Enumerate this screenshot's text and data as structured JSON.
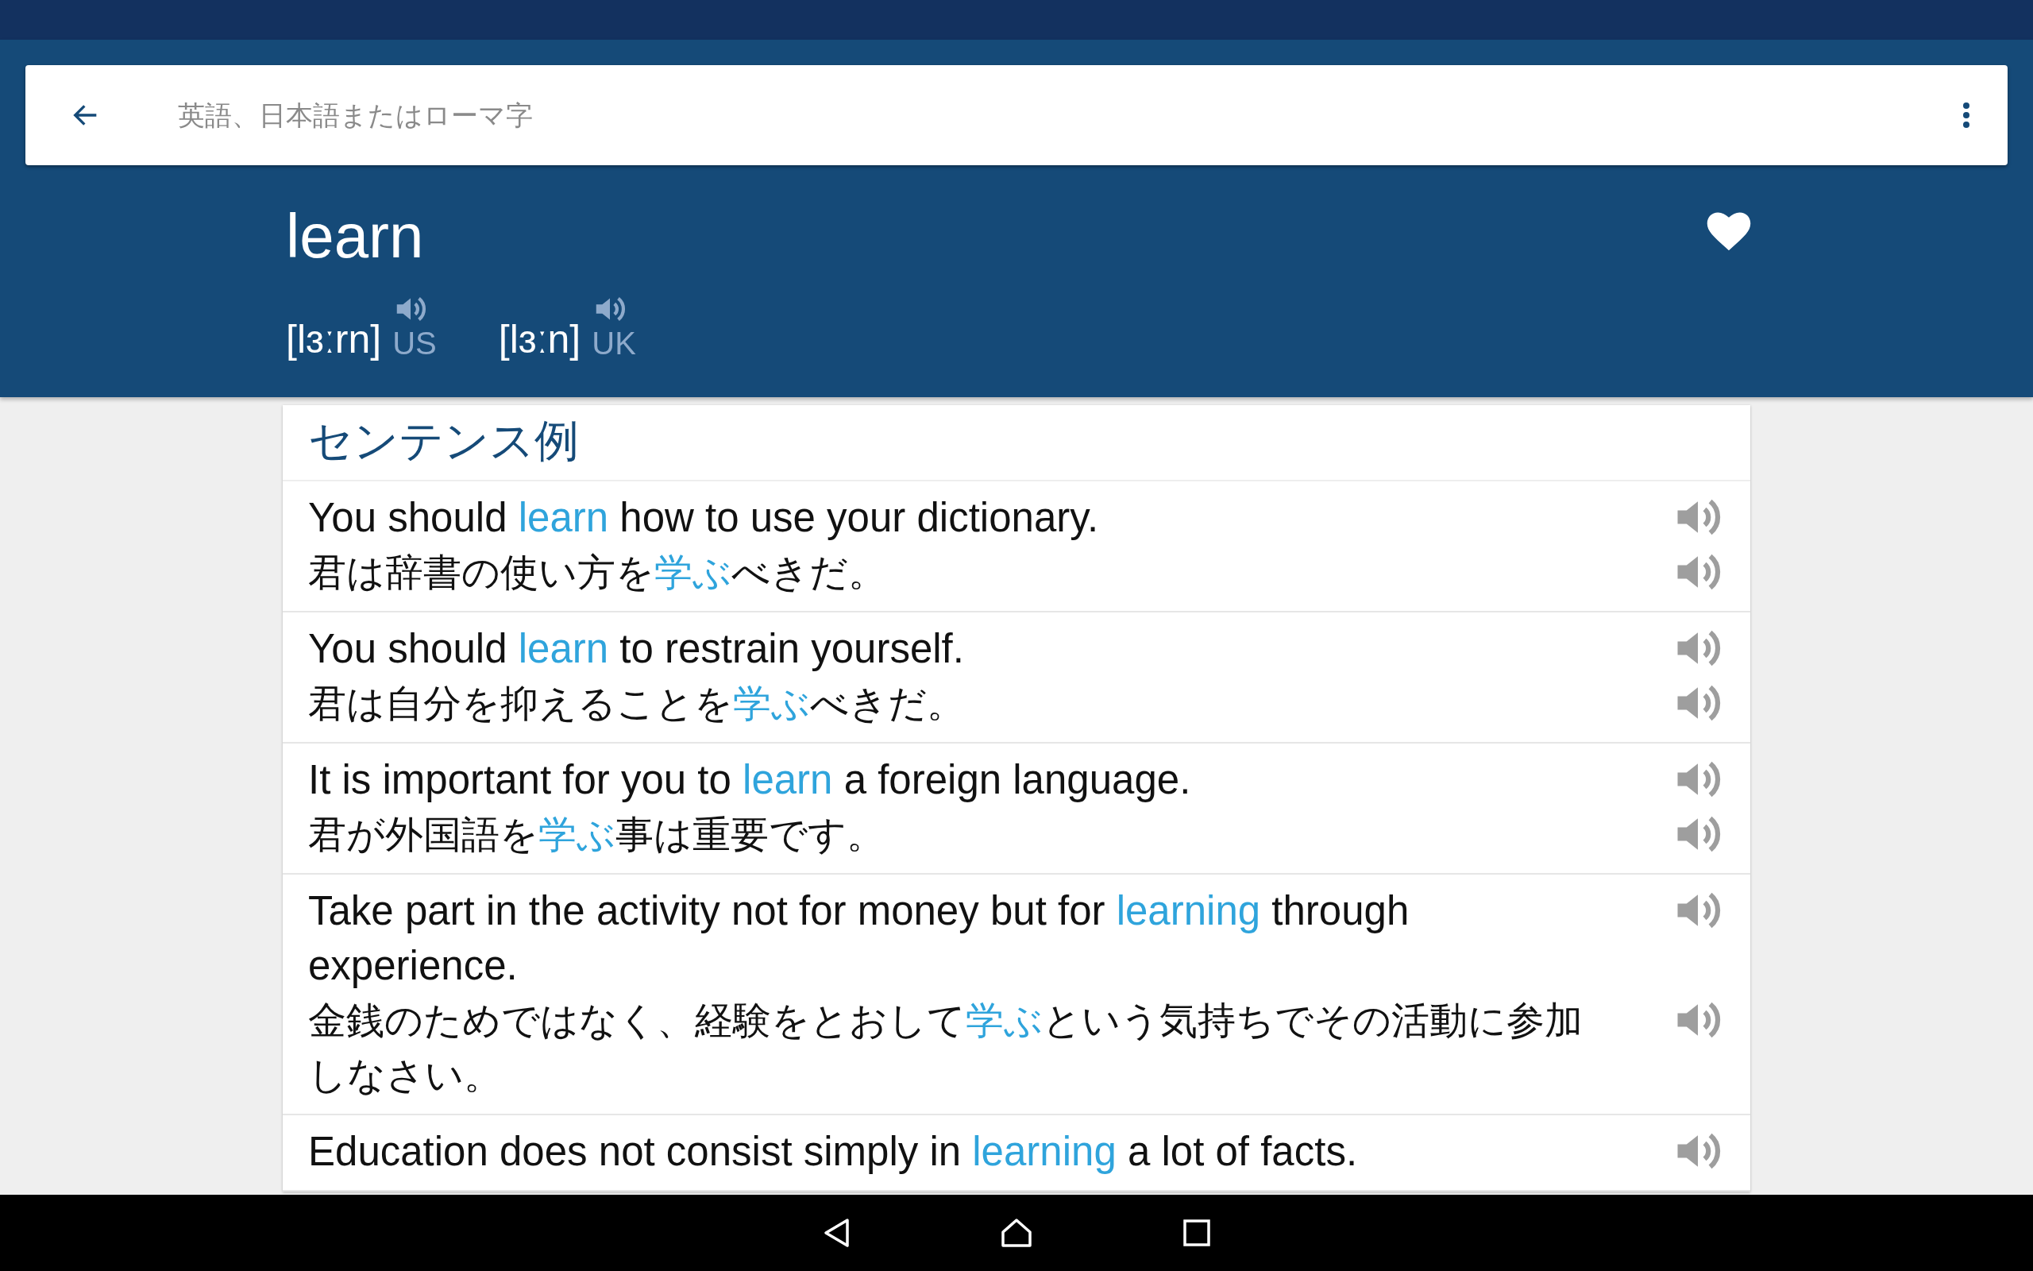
{
  "search": {
    "placeholder": "英語、日本語またはローマ字"
  },
  "entry": {
    "word": "learn",
    "favorite": true,
    "pronunciations": [
      {
        "ipa": "[lɜːrn]",
        "region": "US"
      },
      {
        "ipa": "[lɜːn]",
        "region": "UK"
      }
    ]
  },
  "examples": {
    "title": "センテンス例",
    "rows": [
      {
        "english": [
          {
            "text": "You should ",
            "highlight": false
          },
          {
            "text": "learn",
            "highlight": true
          },
          {
            "text": " how to use your dictionary.",
            "highlight": false
          }
        ],
        "japanese": [
          {
            "text": "君は辞書の使い方を",
            "highlight": false
          },
          {
            "text": "学ぶ",
            "highlight": true
          },
          {
            "text": "べきだ。",
            "highlight": false
          }
        ]
      },
      {
        "english": [
          {
            "text": "You should ",
            "highlight": false
          },
          {
            "text": "learn",
            "highlight": true
          },
          {
            "text": " to restrain yourself.",
            "highlight": false
          }
        ],
        "japanese": [
          {
            "text": "君は自分を抑えることを",
            "highlight": false
          },
          {
            "text": "学ぶ",
            "highlight": true
          },
          {
            "text": "べきだ。",
            "highlight": false
          }
        ]
      },
      {
        "english": [
          {
            "text": "It is important for you to ",
            "highlight": false
          },
          {
            "text": "learn",
            "highlight": true
          },
          {
            "text": " a foreign language.",
            "highlight": false
          }
        ],
        "japanese": [
          {
            "text": "君が外国語を",
            "highlight": false
          },
          {
            "text": "学ぶ",
            "highlight": true
          },
          {
            "text": "事は重要です。",
            "highlight": false
          }
        ]
      },
      {
        "english": [
          {
            "text": "Take part in the activity not for money but for ",
            "highlight": false
          },
          {
            "text": "learning",
            "highlight": true
          },
          {
            "text": " through experience.",
            "highlight": false
          }
        ],
        "japanese": [
          {
            "text": "金銭のためではなく、経験をとおして",
            "highlight": false
          },
          {
            "text": "学ぶ",
            "highlight": true
          },
          {
            "text": "という気持ちでその活動に参加しなさい。",
            "highlight": false
          }
        ]
      },
      {
        "english": [
          {
            "text": "Education does not consist simply in ",
            "highlight": false
          },
          {
            "text": "learning",
            "highlight": true
          },
          {
            "text": " a lot of facts.",
            "highlight": false
          }
        ]
      }
    ]
  }
}
